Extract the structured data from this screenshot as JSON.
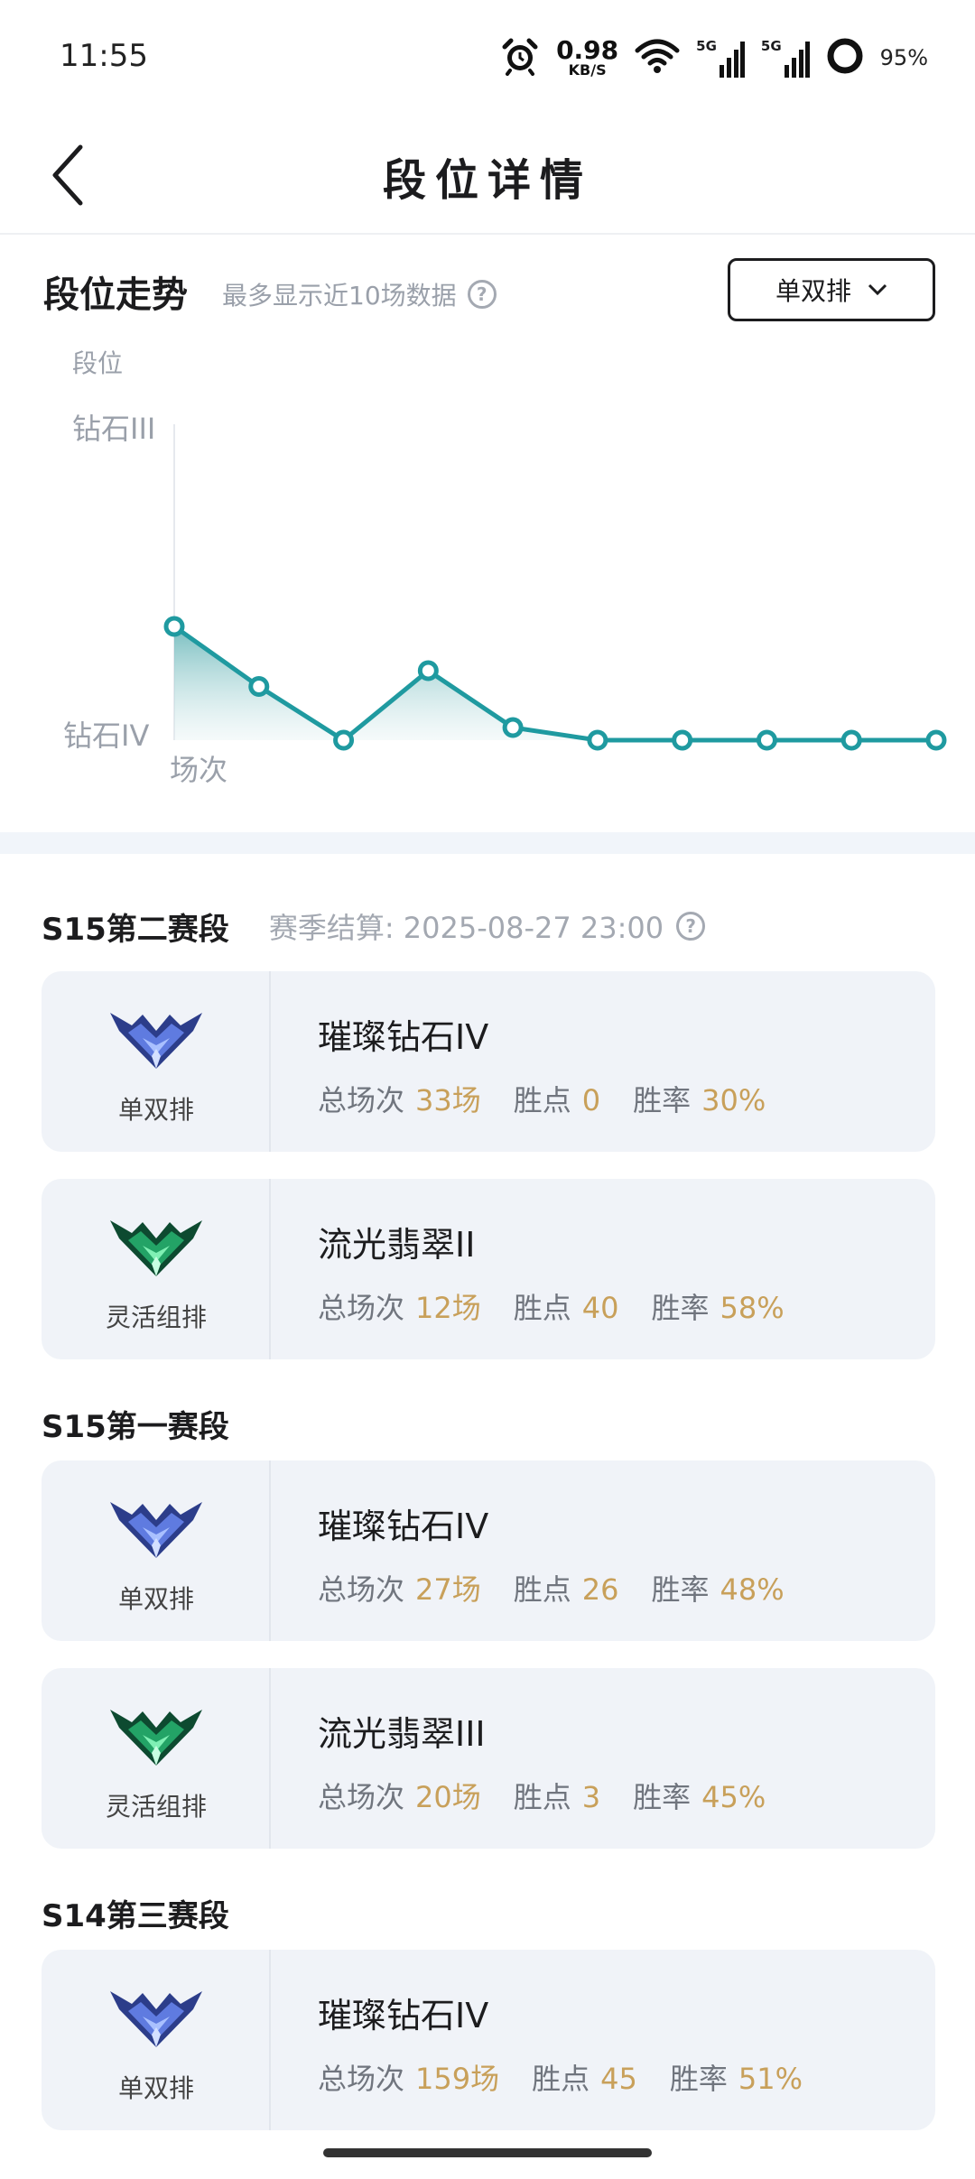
{
  "status_bar": {
    "time": "11:55",
    "net_speed_value": "0.98",
    "net_speed_unit": "KB/S",
    "network_badge_1": "5G",
    "network_badge_2": "5G",
    "battery": "95%"
  },
  "header": {
    "title": "段位详情"
  },
  "trend": {
    "title": "段位走势",
    "note": "最多显示近10场数据",
    "queue_select": "单双排",
    "y_axis_title": "段位",
    "x_axis_title": "场次"
  },
  "chart_data": {
    "type": "area",
    "ylabel": "段位",
    "xlabel": "场次",
    "y_ticks": [
      "钻石IV",
      "钻石III"
    ],
    "x": [
      1,
      2,
      3,
      4,
      5,
      6,
      7,
      8,
      9,
      10
    ],
    "values": [
      0.36,
      0.17,
      0.0,
      0.22,
      0.04,
      0.0,
      0.0,
      0.0,
      0.0,
      0.0
    ],
    "ylim": [
      0,
      1
    ],
    "grid": false,
    "color": "#1f9aa0"
  },
  "seasons": [
    {
      "name": "S15第二赛段",
      "settle": "赛季结算: 2025-08-27 23:00",
      "cards": [
        {
          "queue": "单双排",
          "rank": "璀璨钻石IV",
          "emblem": "diamond",
          "games_label": "总场次",
          "games": "33场",
          "points_label": "胜点",
          "points": "0",
          "winrate_label": "胜率",
          "winrate": "30%"
        },
        {
          "queue": "灵活组排",
          "rank": "流光翡翠II",
          "emblem": "emerald",
          "games_label": "总场次",
          "games": "12场",
          "points_label": "胜点",
          "points": "40",
          "winrate_label": "胜率",
          "winrate": "58%"
        }
      ]
    },
    {
      "name": "S15第一赛段",
      "settle": "",
      "cards": [
        {
          "queue": "单双排",
          "rank": "璀璨钻石IV",
          "emblem": "diamond",
          "games_label": "总场次",
          "games": "27场",
          "points_label": "胜点",
          "points": "26",
          "winrate_label": "胜率",
          "winrate": "48%"
        },
        {
          "queue": "灵活组排",
          "rank": "流光翡翠III",
          "emblem": "emerald",
          "games_label": "总场次",
          "games": "20场",
          "points_label": "胜点",
          "points": "3",
          "winrate_label": "胜率",
          "winrate": "45%"
        }
      ]
    },
    {
      "name": "S14第三赛段",
      "settle": "",
      "cards": [
        {
          "queue": "单双排",
          "rank": "璀璨钻石IV",
          "emblem": "diamond",
          "games_label": "总场次",
          "games": "159场",
          "points_label": "胜点",
          "points": "45",
          "winrate_label": "胜率",
          "winrate": "51%"
        }
      ]
    }
  ]
}
